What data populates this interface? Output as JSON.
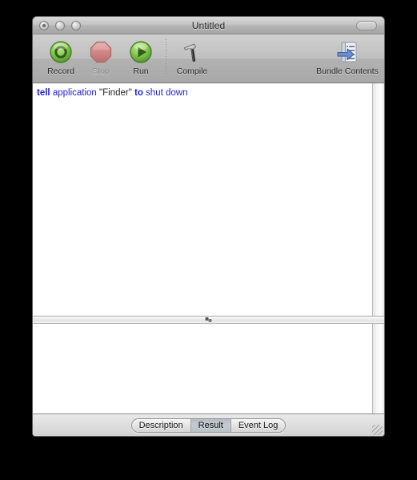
{
  "window": {
    "title": "Untitled",
    "traffic_lights": [
      "close",
      "minimize",
      "zoom"
    ],
    "toolbar_toggle": "toolbar-toggle-pill"
  },
  "toolbar": {
    "items": [
      {
        "label": "Record",
        "icon": "record-icon",
        "enabled": true
      },
      {
        "label": "Stop",
        "icon": "stop-icon",
        "enabled": false
      },
      {
        "label": "Run",
        "icon": "run-icon",
        "enabled": true
      },
      {
        "label": "Compile",
        "icon": "compile-hammer-icon",
        "enabled": true
      },
      {
        "label": "Bundle Contents",
        "icon": "bundle-contents-icon",
        "enabled": true
      }
    ]
  },
  "editor": {
    "script_tokens": [
      {
        "text": "tell",
        "kind": "keyword"
      },
      {
        "text": " ",
        "kind": "plain"
      },
      {
        "text": "application",
        "kind": "application"
      },
      {
        "text": " ",
        "kind": "plain"
      },
      {
        "text": "\"Finder\"",
        "kind": "string"
      },
      {
        "text": " ",
        "kind": "plain"
      },
      {
        "text": "to",
        "kind": "keyword"
      },
      {
        "text": " ",
        "kind": "plain"
      },
      {
        "text": "shut down",
        "kind": "command"
      }
    ],
    "script_plain": "tell application \"Finder\" to shut down"
  },
  "result": {
    "text": ""
  },
  "bottom_bar": {
    "tabs": [
      {
        "label": "Description",
        "selected": false
      },
      {
        "label": "Result",
        "selected": true
      },
      {
        "label": "Event Log",
        "selected": false
      }
    ]
  },
  "colors": {
    "keyword": "#2222cc",
    "application": "#2222cc",
    "string": "#222222",
    "command": "#2222cc",
    "record_green": "#74c24a",
    "stop_red": "#d08080",
    "run_green": "#74c24a",
    "desktop_background": "#000000"
  }
}
